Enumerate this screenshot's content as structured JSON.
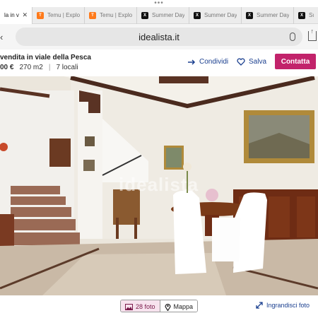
{
  "browser": {
    "top_dots": "•••",
    "tabs": [
      {
        "label": "la in vi",
        "active": true,
        "icon": "idealista-icon"
      },
      {
        "label": "Temu | Explo",
        "icon": "temu-icon"
      },
      {
        "label": "Temu | Explo",
        "icon": "temu-icon"
      },
      {
        "label": "Summer Day",
        "icon": "x-icon"
      },
      {
        "label": "Summer Day",
        "icon": "x-icon"
      },
      {
        "label": "Summer Day",
        "icon": "x-icon"
      },
      {
        "label": "Su",
        "icon": "x-icon"
      }
    ],
    "address": "idealista.it"
  },
  "listing": {
    "title": "vendita in viale della Pesca",
    "price": "00 €",
    "area": "270 m2",
    "rooms": "7 locali",
    "share_label": "Condividi",
    "save_label": "Salva",
    "contact_label": "Contatta"
  },
  "photo": {
    "watermark": "idealista"
  },
  "bottom": {
    "photos_label": "28 foto",
    "map_label": "Mappa",
    "enlarge_label": "Ingrandisci foto"
  },
  "colors": {
    "accent": "#c2236b",
    "link": "#1a3f8f"
  }
}
